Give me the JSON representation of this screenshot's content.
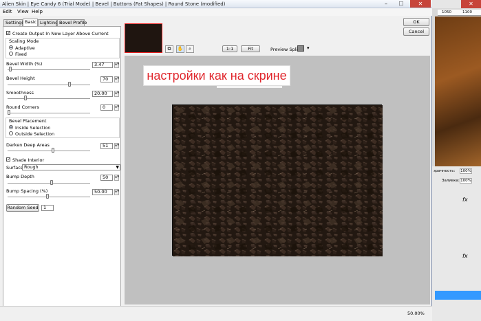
{
  "window": {
    "title": "Alien Skin | Eye Candy 6 (Trial Mode) | Bevel | Buttons (Fat Shapes) | Round Stone (modified)",
    "minimize": "–",
    "maximize": "☐",
    "close": "✕"
  },
  "menu": [
    "Edit",
    "View",
    "Help"
  ],
  "tabs": [
    "Settings",
    "Basic",
    "Lighting",
    "Bevel Profile"
  ],
  "active_tab": "Basic",
  "basic": {
    "create_output_label": "Create Output In New Layer Above Current",
    "scaling_mode": {
      "title": "Scaling Mode",
      "options": [
        "Adaptive",
        "Fixed"
      ],
      "selected": "Adaptive"
    },
    "bevel_width": {
      "label": "Bevel Width (%)",
      "value": "3.47",
      "level": 0.03
    },
    "bevel_height": {
      "label": "Bevel Height",
      "value": "70",
      "level": 0.7
    },
    "smoothness": {
      "label": "Smoothness",
      "value": "20.00",
      "level": 0.2
    },
    "round_corners": {
      "label": "Round Corners",
      "value": "0",
      "level": 0.0
    },
    "bevel_placement": {
      "title": "Bevel Placement",
      "options": [
        "Inside Selection",
        "Outside Selection"
      ],
      "selected": "Inside Selection"
    },
    "darken_deep_areas": {
      "label": "Darken Deep Areas",
      "value": "51",
      "level": 0.51
    },
    "shade_interior_label": "Shade Interior",
    "surface": {
      "label": "Surface:",
      "value": "Rough"
    },
    "bump_depth": {
      "label": "Bump Depth",
      "value": "50",
      "level": 0.5
    },
    "bump_spacing": {
      "label": "Bump Spacing (%)",
      "value": "50.00",
      "level": 0.45
    },
    "random_seed": {
      "label": "Random Seed",
      "value": "1"
    }
  },
  "buttons": {
    "ok": "OK",
    "cancel": "Cancel"
  },
  "zoom_buttons": [
    "1:1",
    "Fit"
  ],
  "preview_split_label": "Preview Split:",
  "caption": "настройки как на скрине",
  "status_zoom": "50.00%",
  "background_app": {
    "ruler_labels": [
      "1050",
      "1100"
    ],
    "opacity_label": "зрачность:",
    "opacity_value": "100%",
    "fill_label": "Заливка:",
    "fill_value": "100%",
    "fx_label": "fx"
  },
  "colors": {
    "caption_text": "#e0272d",
    "thumbnail_border": "#e22222",
    "preview_bg": "#c0c0c0",
    "texture": "#221811",
    "highlight": "#3399ff"
  }
}
